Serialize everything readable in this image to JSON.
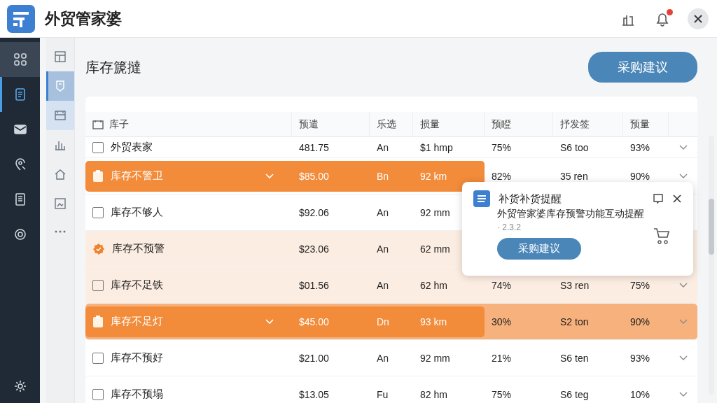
{
  "app": {
    "title": "外贸管家婆"
  },
  "header": {
    "notification_badge": true
  },
  "rail": [
    {
      "selected": true
    },
    {
      "selected": false,
      "accent": true
    },
    {
      "selected": false
    },
    {
      "selected": false
    },
    {
      "selected": false
    },
    {
      "selected": false
    }
  ],
  "subrail": [
    {
      "selected": false
    },
    {
      "selected": true
    },
    {
      "selected": false,
      "soft": true
    },
    {
      "selected": false
    },
    {
      "selected": false
    },
    {
      "selected": false
    }
  ],
  "page": {
    "title": "库存篪撻",
    "action": "采购建议"
  },
  "table": {
    "columns": [
      "库子",
      "预遣",
      "乐选",
      "损量",
      "预瞪",
      "抒发签",
      "预量"
    ],
    "rows": [
      {
        "kind": "checkbox",
        "highlighted": false,
        "shaded": false,
        "cells": [
          "外贸表家",
          "481.75",
          "An",
          "$1 hmp",
          "75%",
          "S6 too",
          "93%"
        ]
      },
      {
        "kind": "clip",
        "highlighted": true,
        "shaded": false,
        "cells": [
          "库存不警卫",
          "$85.00",
          "Bn",
          "92 km",
          "82%",
          "35 ren",
          "90%"
        ]
      },
      {
        "kind": "checkbox",
        "highlighted": false,
        "shaded": false,
        "cells": [
          "库存不够人",
          "$92.06",
          "An",
          "92 mm"
        ]
      },
      {
        "kind": "badge",
        "highlighted": false,
        "shaded": true,
        "cells": [
          "库存不预警",
          "$23.06",
          "An",
          "62 mm"
        ]
      },
      {
        "kind": "checkbox",
        "highlighted": false,
        "shaded": true,
        "cells": [
          "库存不足铁",
          "$01.56",
          "An",
          "62 hm",
          "74%",
          "S3 ren",
          "75%"
        ]
      },
      {
        "kind": "clip",
        "highlighted": true,
        "shaded": true,
        "cells": [
          "库存不足灯",
          "$45.00",
          "Dn",
          "93 km",
          "30%",
          "S2 ton",
          "90%"
        ]
      },
      {
        "kind": "checkbox",
        "highlighted": false,
        "shaded": false,
        "cells": [
          "库存不预好",
          "$21.00",
          "An",
          "92 mm",
          "21%",
          "S6 ten",
          "93%"
        ]
      },
      {
        "kind": "checkbox",
        "highlighted": false,
        "shaded": false,
        "cells": [
          "库存不预塌",
          "$13.05",
          "Fu",
          "82 hm",
          "75%",
          "S6 teg",
          "10%"
        ]
      }
    ]
  },
  "popup": {
    "title": "补货补货提醒",
    "message": "外贸管家婆库存预警功能互动提醒",
    "version": "· 2.3.2",
    "action": "采购建议"
  }
}
